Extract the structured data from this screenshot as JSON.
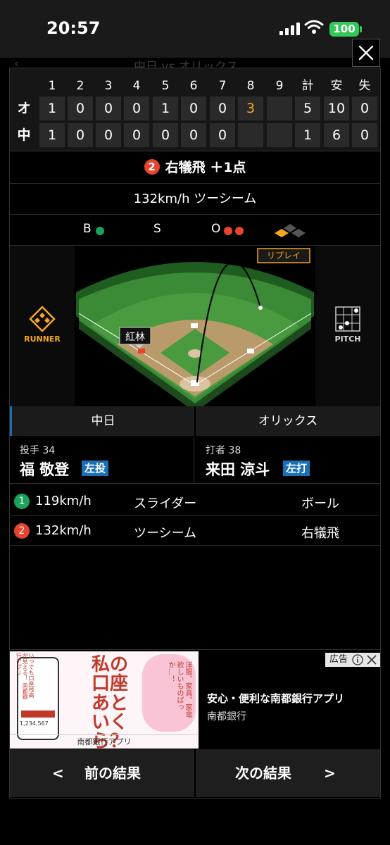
{
  "status": {
    "time": "20:57",
    "battery": "100"
  },
  "background": {
    "title": "中日 vs オリックス"
  },
  "scoreboard": {
    "headers": [
      "1",
      "2",
      "3",
      "4",
      "5",
      "6",
      "7",
      "8",
      "9",
      "計",
      "安",
      "失"
    ],
    "teams": [
      {
        "name": "オ",
        "innings": [
          "1",
          "0",
          "0",
          "0",
          "1",
          "0",
          "0",
          "3",
          ""
        ],
        "totals": [
          "5",
          "10",
          "0"
        ]
      },
      {
        "name": "中",
        "innings": [
          "1",
          "0",
          "0",
          "0",
          "0",
          "0",
          "0",
          "",
          ""
        ],
        "totals": [
          "1",
          "6",
          "0"
        ]
      }
    ]
  },
  "play": {
    "number": "2",
    "result": "右犠飛 ＋1点"
  },
  "pitch": {
    "speed_type": "132km/h ツーシーム"
  },
  "count": {
    "ball_label": "B",
    "strike_label": "S",
    "out_label": "O",
    "balls": 1,
    "strikes": 0,
    "outs": 2
  },
  "field": {
    "replay_label": "リプレイ",
    "runner_label": "RUNNER",
    "pitch_label": "PITCH",
    "runner_name": "紅林"
  },
  "teams": {
    "home": "中日",
    "away": "オリックス"
  },
  "players": {
    "pitcher": {
      "role": "投手 34",
      "name": "福 敬登",
      "hand": "左投"
    },
    "batter": {
      "role": "打者 38",
      "name": "来田 涼斗",
      "hand": "左打"
    }
  },
  "pitches": [
    {
      "num": "1",
      "speed": "119km/h",
      "type": "スライダー",
      "result": "ボール",
      "color": "#1aa35a"
    },
    {
      "num": "2",
      "speed": "132km/h",
      "type": "ツーシーム",
      "result": "右犠飛",
      "color": "#e8432e"
    }
  ],
  "ad": {
    "badge": "広告",
    "title": "安心・便利な南都銀行アプリ",
    "sponsor": "南都銀行",
    "image_headline": "私の口座 あといくら？",
    "image_bubble": "洋服、家具、家電 欲しいものばっか…！",
    "image_footer": "南都銀行アプリ",
    "image_side": "いつでも口座残高が見える！ 南都銀行アプリ",
    "image_amount": "1,234,567"
  },
  "nav": {
    "prev": "前の結果",
    "next": "次の結果"
  },
  "colors": {
    "accent": "#f5a623",
    "ball": "#1aa35a",
    "out": "#e8432e",
    "hand_badge": "#1b6fb5"
  }
}
